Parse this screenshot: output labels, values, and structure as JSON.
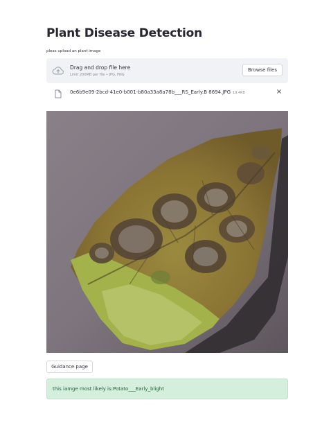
{
  "page": {
    "title": "Plant Disease Detection"
  },
  "uploader": {
    "label": "pleas upload an plant image",
    "dropzone_text": "Drag and drop file here",
    "limit_text": "Limit 200MB per file • JPG, PNG",
    "browse_label": "Browse files",
    "icon": "cloud-upload-icon"
  },
  "uploaded_file": {
    "name": "0e6b9e09-2bcd-41e0-b001-b80a33a8a78b___RS_Early.B 8694.JPG",
    "size": "19.4KB",
    "icon": "file-icon",
    "close_symbol": "×"
  },
  "image": {
    "subject": "potato leaf with early blight lesions"
  },
  "guidance_button": {
    "label": "Guidance page"
  },
  "result": {
    "text": "this iamge most likely is:Potato___Early_blight",
    "color": "#d4efdc"
  }
}
